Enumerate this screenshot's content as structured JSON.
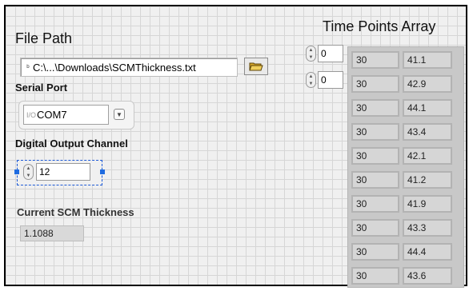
{
  "file_path": {
    "label": "File Path",
    "value": "C:\\...\\Downloads\\SCMThickness.txt",
    "browse_icon": "folder-open-icon"
  },
  "serial_port": {
    "label": "Serial Port",
    "value": "COM7"
  },
  "digital_output": {
    "label": "Digital Output Channel",
    "value": "12"
  },
  "current_thickness": {
    "label": "Current SCM Thickness",
    "value": "1.1088"
  },
  "time_points": {
    "label": "Time Points Array",
    "row_index": "0",
    "col_index": "0",
    "rows": [
      [
        "30",
        "41.1"
      ],
      [
        "30",
        "42.9"
      ],
      [
        "30",
        "44.1"
      ],
      [
        "30",
        "43.4"
      ],
      [
        "30",
        "42.1"
      ],
      [
        "30",
        "41.2"
      ],
      [
        "30",
        "41.9"
      ],
      [
        "30",
        "43.3"
      ],
      [
        "30",
        "44.4"
      ],
      [
        "30",
        "43.6"
      ]
    ]
  }
}
